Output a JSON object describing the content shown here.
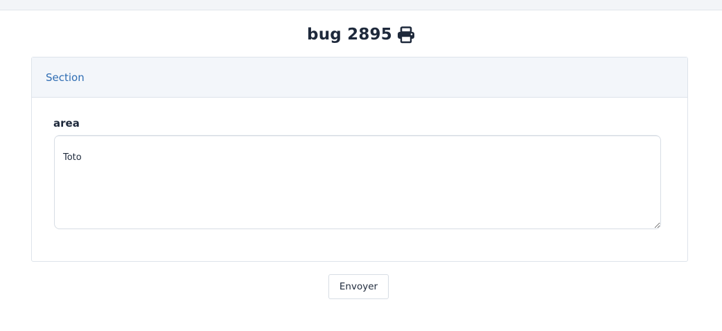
{
  "page": {
    "title": "bug 2895",
    "print_icon": "print-icon"
  },
  "section": {
    "title": "Section",
    "field": {
      "label": "area",
      "value": "Toto"
    }
  },
  "actions": {
    "submit_label": "Envoyer"
  }
}
